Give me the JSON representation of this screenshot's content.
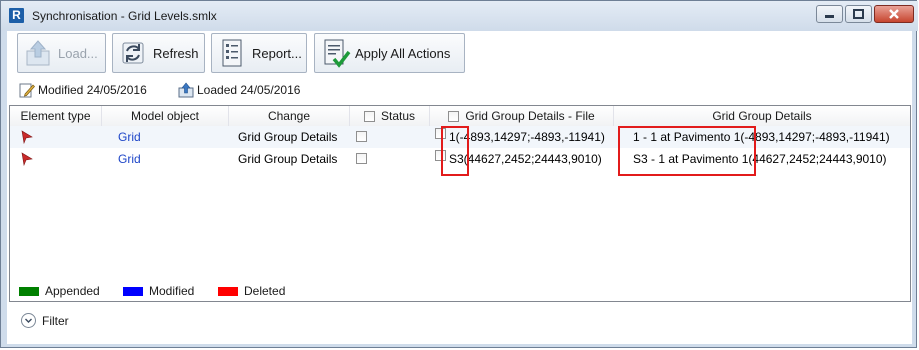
{
  "window": {
    "app_icon_letter": "R",
    "title": "Synchronisation - Grid Levels.smlx"
  },
  "toolbar": {
    "load_label": "Load...",
    "refresh_label": "Refresh",
    "report_label": "Report...",
    "apply_label": "Apply All Actions"
  },
  "info": {
    "modified": "Modified 24/05/2016",
    "loaded": "Loaded 24/05/2016"
  },
  "table": {
    "headers": {
      "element_type": "Element type",
      "model_object": "Model object",
      "change": "Change",
      "status": "Status",
      "details_file": "Grid Group Details - File",
      "details": "Grid Group Details"
    },
    "rows": [
      {
        "model_object": "Grid",
        "change": "Grid Group Details",
        "details_file": "1(-4893,14297;-4893,-11941)",
        "details": "1 - 1 at Pavimento 1(-4893,14297;-4893,-11941)"
      },
      {
        "model_object": "Grid",
        "change": "Grid Group Details",
        "details_file": "S3(44627,2452;24443,9010)",
        "details": "S3 - 1 at Pavimento 1(44627,2452;24443,9010)"
      }
    ]
  },
  "legend": {
    "appended": {
      "label": "Appended",
      "color": "#008000"
    },
    "modified": {
      "label": "Modified",
      "color": "#0000ff"
    },
    "deleted": {
      "label": "Deleted",
      "color": "#ff0000"
    }
  },
  "filter_label": "Filter",
  "colors": {
    "highlight": "#e21b1b",
    "link": "#1e46c8"
  }
}
